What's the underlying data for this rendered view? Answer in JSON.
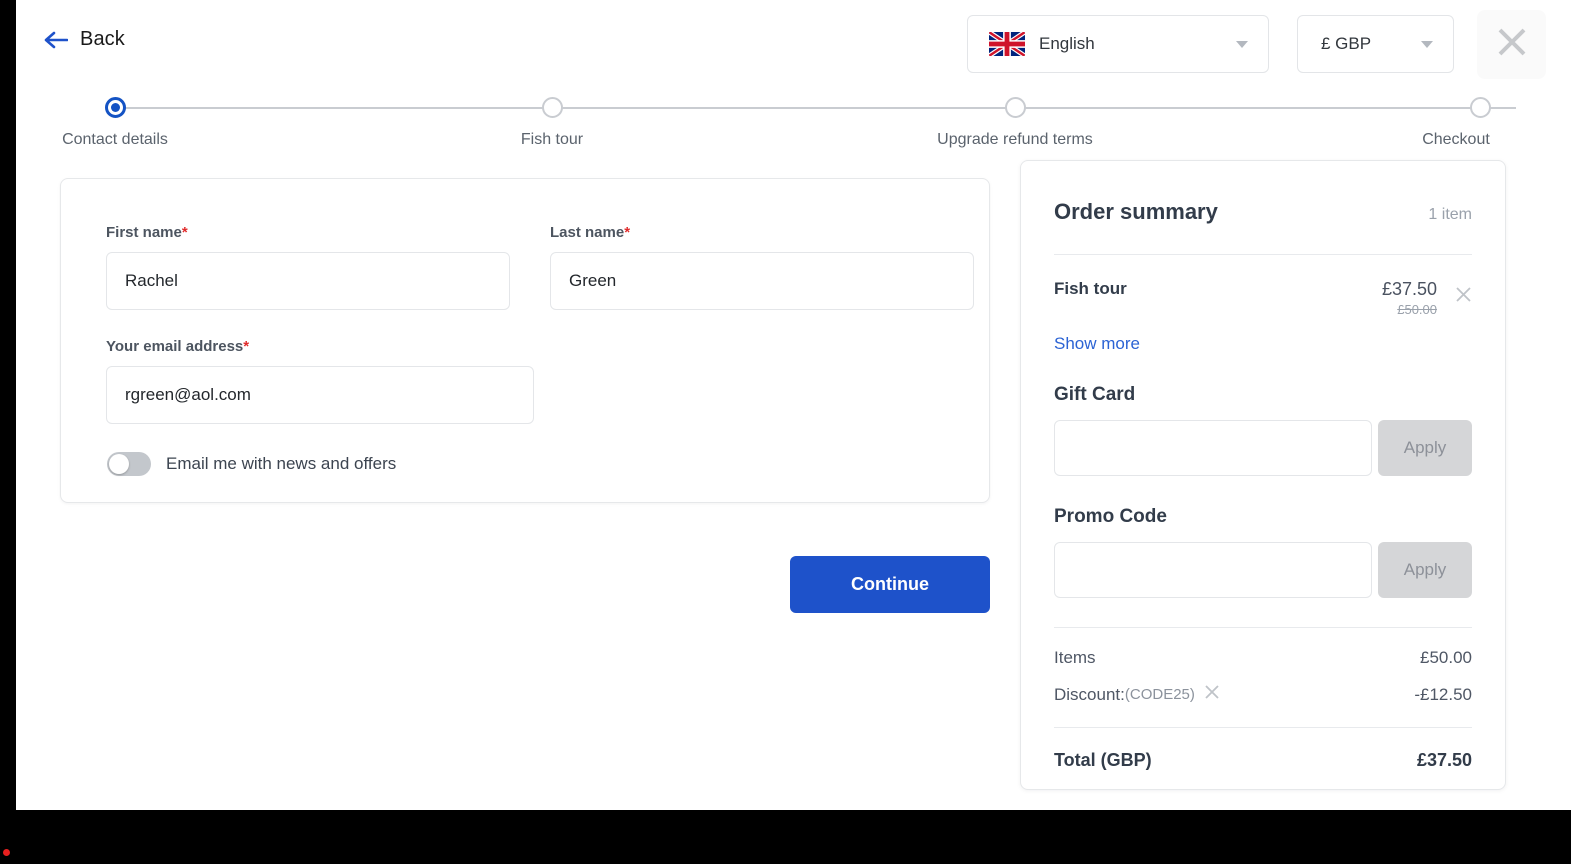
{
  "header": {
    "back_label": "Back",
    "back_icon": "arrow-left-icon",
    "language": {
      "value": "English",
      "flag": "uk-flag-icon",
      "caret": "chevron-down-icon"
    },
    "currency": {
      "value": "£ GBP",
      "caret": "chevron-down-icon"
    },
    "close_icon": "close-icon"
  },
  "stepper": {
    "steps": [
      {
        "label": "Contact details",
        "state": "active"
      },
      {
        "label": "Fish tour",
        "state": "upcoming"
      },
      {
        "label": "Upgrade refund terms",
        "state": "upcoming"
      },
      {
        "label": "Checkout",
        "state": "upcoming"
      }
    ]
  },
  "form": {
    "first_name": {
      "label": "First name",
      "required_mark": "*",
      "value": "Rachel",
      "placeholder": "First name"
    },
    "last_name": {
      "label": "Last name",
      "required_mark": "*",
      "value": "Green",
      "placeholder": "Last name"
    },
    "email": {
      "label": "Your email address",
      "required_mark": "*",
      "value": "rgreen@aol.com",
      "placeholder": "Your email address"
    },
    "newsletter": {
      "label": "Email me with news and offers",
      "state": "off"
    },
    "continue_label": "Continue"
  },
  "summary": {
    "title": "Order summary",
    "item_count": "1 item",
    "item": {
      "name": "Fish tour",
      "price": "£37.50",
      "old_price": "£50.00",
      "remove_icon": "close-icon",
      "show_more": "Show more"
    },
    "gift_card": {
      "title": "Gift Card",
      "value": "",
      "placeholder": "",
      "apply_label": "Apply"
    },
    "promo_code": {
      "title": "Promo Code",
      "value": "",
      "placeholder": "",
      "apply_label": "Apply"
    },
    "totals": {
      "items_label": "Items",
      "items_value": "£50.00",
      "discount_label": "Discount:",
      "discount_code": "(CODE25)",
      "discount_remove_icon": "close-icon",
      "discount_value": "-£12.50",
      "total_label": "Total (GBP)",
      "total_value": "£37.50"
    }
  },
  "colors": {
    "accent": "#1e52ca",
    "link": "#2b63d4",
    "required": "#e02b2b",
    "muted": "#9aa1ab",
    "rec_dot": "#e8201f"
  }
}
